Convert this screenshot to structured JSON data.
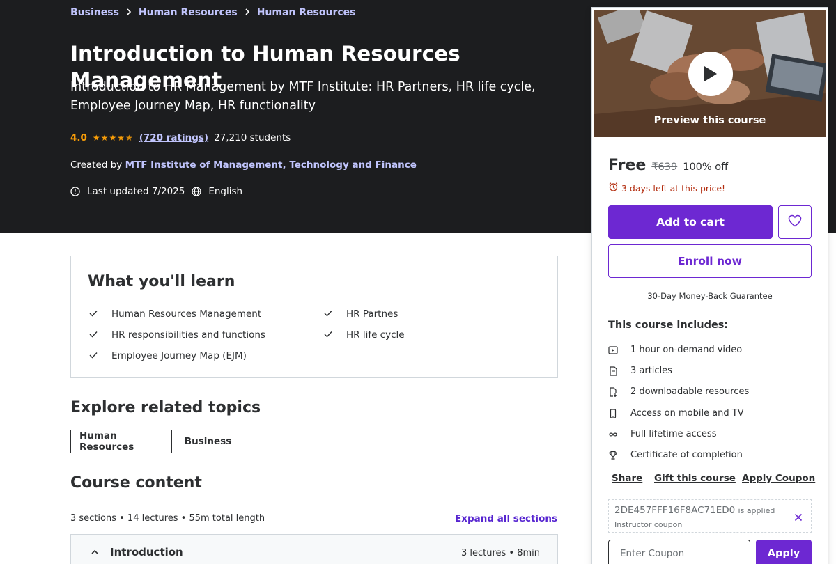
{
  "breadcrumb": [
    "Business",
    "Human Resources",
    "Human Resources"
  ],
  "course": {
    "title": "Introduction to Human Resources Management",
    "subtitle": "Introduction to HR Management by MTF Institute: HR Partners, HR life cycle, Employee Journey Map, HR functionality",
    "rating": "4.0",
    "ratings_count": "(720 ratings)",
    "students": "27,210 students",
    "created_by_label": "Created by",
    "instructor": "MTF Institute of Management, Technology and Finance",
    "last_updated": "Last updated 7/2025",
    "language": "English"
  },
  "learn": {
    "title": "What you'll learn",
    "items": [
      "Human Resources Management",
      "HR Partnes",
      "HR responsibilities and functions",
      "HR life cycle",
      "Employee Journey Map (EJM)"
    ]
  },
  "topics": {
    "title": "Explore related topics",
    "items": [
      "Human Resources",
      "Business"
    ]
  },
  "content": {
    "title": "Course content",
    "summary": "3 sections • 14 lectures • 55m total length",
    "expand_label": "Expand all sections",
    "sections": [
      {
        "title": "Introduction",
        "info": "3 lectures • 8min"
      }
    ]
  },
  "sidebar": {
    "preview_label": "Preview this course",
    "price": "Free",
    "original_price": "₹639",
    "discount": "100% off",
    "urgency": "3 days left at this price!",
    "add_to_cart": "Add to cart",
    "enroll": "Enroll now",
    "guarantee": "30-Day Money-Back Guarantee",
    "includes_title": "This course includes:",
    "includes": [
      {
        "icon": "video-icon",
        "label": "1 hour on-demand video"
      },
      {
        "icon": "article-icon",
        "label": "3 articles"
      },
      {
        "icon": "download-file-icon",
        "label": "2 downloadable resources"
      },
      {
        "icon": "mobile-icon",
        "label": "Access on mobile and TV"
      },
      {
        "icon": "infinity-icon",
        "label": "Full lifetime access"
      },
      {
        "icon": "trophy-icon",
        "label": "Certificate of completion"
      }
    ],
    "share": "Share",
    "gift": "Gift this course",
    "apply_coupon": "Apply Coupon",
    "coupon_code": "2DE457FFF16F8AC71ED0",
    "coupon_applied": "is applied",
    "coupon_type": "Instructor coupon",
    "coupon_placeholder": "Enter Coupon",
    "apply": "Apply"
  },
  "colors": {
    "hero_bg": "#1c1d1f",
    "accent": "#6d28d2",
    "link_light": "#c0c4fc",
    "star": "#f69c08",
    "urgency": "#b32d0f"
  }
}
